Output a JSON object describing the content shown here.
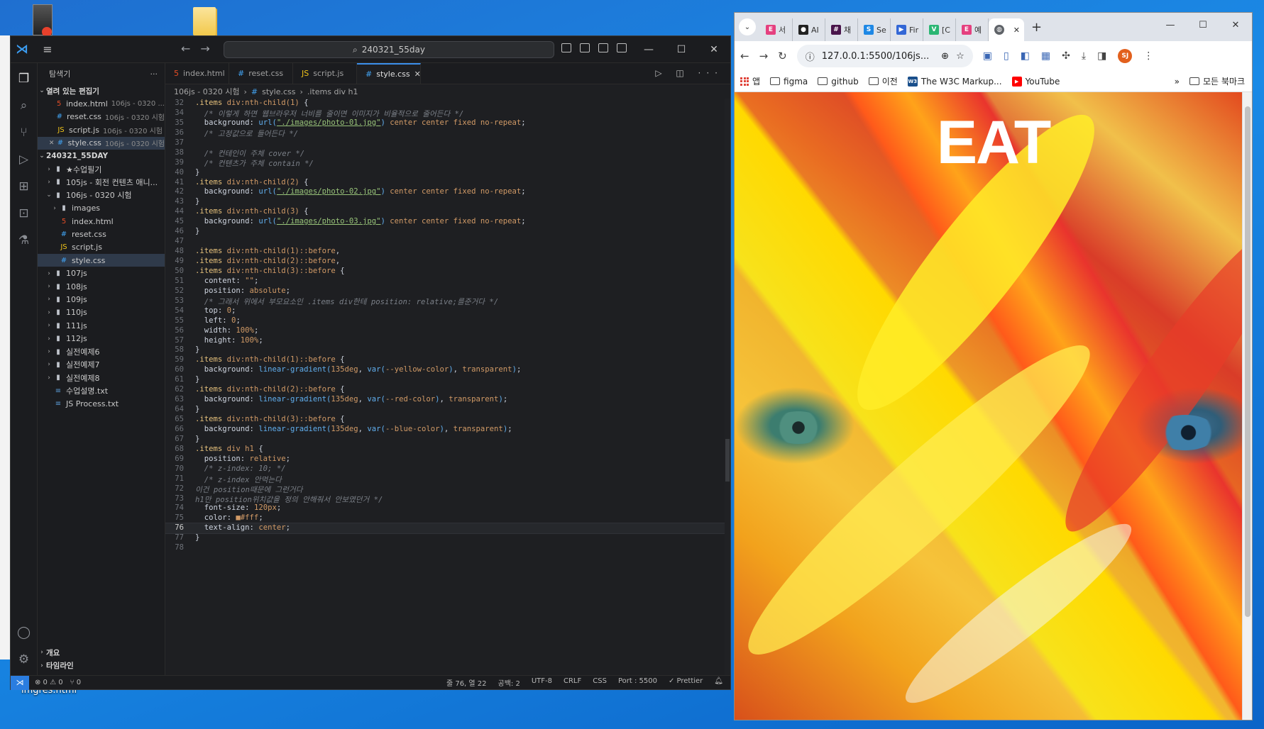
{
  "desktop": {
    "file_label": "imgres.html"
  },
  "vscode": {
    "search_text": "240321_55day",
    "explorer_title": "탐색기",
    "open_editors_label": "열려 있는 편집기",
    "open_editors": [
      {
        "name": "index.html",
        "desc": "106js - 0320 ...",
        "kind": "html"
      },
      {
        "name": "reset.css",
        "desc": "106js - 0320 시험",
        "kind": "css"
      },
      {
        "name": "script.js",
        "desc": "106js - 0320 시험",
        "kind": "js"
      },
      {
        "name": "style.css",
        "desc": "106js - 0320 시험",
        "kind": "css"
      }
    ],
    "workspace_label": "240321_55DAY",
    "tree": [
      {
        "name": "★수업필기",
        "kind": "folder",
        "indent": 1
      },
      {
        "name": "105js - 회전 컨텐츠 애니...",
        "kind": "folder",
        "indent": 1
      },
      {
        "name": "106js - 0320 시험",
        "kind": "folder-open",
        "indent": 1
      },
      {
        "name": "images",
        "kind": "folder",
        "indent": 2
      },
      {
        "name": "index.html",
        "kind": "html",
        "indent": 2
      },
      {
        "name": "reset.css",
        "kind": "css",
        "indent": 2
      },
      {
        "name": "script.js",
        "kind": "js",
        "indent": 2
      },
      {
        "name": "style.css",
        "kind": "css",
        "indent": 2
      },
      {
        "name": "107js",
        "kind": "folder",
        "indent": 1
      },
      {
        "name": "108js",
        "kind": "folder",
        "indent": 1
      },
      {
        "name": "109js",
        "kind": "folder",
        "indent": 1
      },
      {
        "name": "110js",
        "kind": "folder",
        "indent": 1
      },
      {
        "name": "111js",
        "kind": "folder",
        "indent": 1
      },
      {
        "name": "112js",
        "kind": "folder",
        "indent": 1
      },
      {
        "name": "실전예제6",
        "kind": "folder",
        "indent": 1
      },
      {
        "name": "실전예제7",
        "kind": "folder",
        "indent": 1
      },
      {
        "name": "실전예제8",
        "kind": "folder",
        "indent": 1
      },
      {
        "name": "수업설명.txt",
        "kind": "txt",
        "indent": 1
      },
      {
        "name": "JS Process.txt",
        "kind": "txt",
        "indent": 1
      }
    ],
    "outline_label": "개요",
    "timeline_label": "타임라인",
    "tabs": [
      {
        "name": "index.html",
        "kind": "html"
      },
      {
        "name": "reset.css",
        "kind": "css"
      },
      {
        "name": "script.js",
        "kind": "js"
      },
      {
        "name": "style.css",
        "kind": "css"
      }
    ],
    "breadcrumb": [
      "106js - 0320 시험",
      "style.css",
      ".items div h1"
    ],
    "code_lines": [
      {
        "n": "32",
        "parts": [
          [
            "sel",
            ".items "
          ],
          [
            "sel2",
            "div:nth-child(1)"
          ],
          [
            "txt",
            " {"
          ]
        ]
      },
      {
        "n": "34",
        "parts": [
          [
            "txt",
            "  "
          ],
          [
            "cmt",
            "/* 이렇게 하면 웹브라우저 너비를 줄이면 이미지가 비율적으로 줄어든다 */"
          ]
        ]
      },
      {
        "n": "35",
        "parts": [
          [
            "txt",
            "  "
          ],
          [
            "prop",
            "background: "
          ],
          [
            "fn",
            "url("
          ],
          [
            "str",
            "\"./images/photo-01.jpg\""
          ],
          [
            "fn",
            ")"
          ],
          [
            "val",
            " center center fixed no-repeat"
          ],
          [
            "txt",
            ";"
          ]
        ]
      },
      {
        "n": "36",
        "parts": [
          [
            "txt",
            "  "
          ],
          [
            "cmt",
            "/* 고정값으로 들어든다 */"
          ]
        ]
      },
      {
        "n": "37",
        "parts": []
      },
      {
        "n": "38",
        "parts": [
          [
            "txt",
            "  "
          ],
          [
            "cmt",
            "/* 컨테인이 주체 cover */"
          ]
        ]
      },
      {
        "n": "39",
        "parts": [
          [
            "txt",
            "  "
          ],
          [
            "cmt",
            "/* 컨텐츠가 주체 contain */"
          ]
        ]
      },
      {
        "n": "40",
        "parts": [
          [
            "txt",
            "}"
          ]
        ]
      },
      {
        "n": "41",
        "parts": [
          [
            "sel",
            ".items "
          ],
          [
            "sel2",
            "div:nth-child(2)"
          ],
          [
            "txt",
            " {"
          ]
        ]
      },
      {
        "n": "42",
        "parts": [
          [
            "txt",
            "  "
          ],
          [
            "prop",
            "background: "
          ],
          [
            "fn",
            "url("
          ],
          [
            "str",
            "\"./images/photo-02.jpg\""
          ],
          [
            "fn",
            ")"
          ],
          [
            "val",
            " center center fixed no-repeat"
          ],
          [
            "txt",
            ";"
          ]
        ]
      },
      {
        "n": "43",
        "parts": [
          [
            "txt",
            "}"
          ]
        ]
      },
      {
        "n": "44",
        "parts": [
          [
            "sel",
            ".items "
          ],
          [
            "sel2",
            "div:nth-child(3)"
          ],
          [
            "txt",
            " {"
          ]
        ]
      },
      {
        "n": "45",
        "parts": [
          [
            "txt",
            "  "
          ],
          [
            "prop",
            "background: "
          ],
          [
            "fn",
            "url("
          ],
          [
            "str",
            "\"./images/photo-03.jpg\""
          ],
          [
            "fn",
            ")"
          ],
          [
            "val",
            " center center fixed no-repeat"
          ],
          [
            "txt",
            ";"
          ]
        ]
      },
      {
        "n": "46",
        "parts": [
          [
            "txt",
            "}"
          ]
        ]
      },
      {
        "n": "47",
        "parts": []
      },
      {
        "n": "48",
        "parts": [
          [
            "sel",
            ".items "
          ],
          [
            "sel2",
            "div:nth-child(1)::before"
          ],
          [
            "txt",
            ","
          ]
        ]
      },
      {
        "n": "49",
        "parts": [
          [
            "sel",
            ".items "
          ],
          [
            "sel2",
            "div:nth-child(2)::before"
          ],
          [
            "txt",
            ","
          ]
        ]
      },
      {
        "n": "50",
        "parts": [
          [
            "sel",
            ".items "
          ],
          [
            "sel2",
            "div:nth-child(3)::before"
          ],
          [
            "txt",
            " {"
          ]
        ]
      },
      {
        "n": "51",
        "parts": [
          [
            "txt",
            "  "
          ],
          [
            "prop",
            "content: "
          ],
          [
            "val",
            "\"\""
          ],
          [
            "txt",
            ";"
          ]
        ]
      },
      {
        "n": "52",
        "parts": [
          [
            "txt",
            "  "
          ],
          [
            "prop",
            "position: "
          ],
          [
            "val",
            "absolute"
          ],
          [
            "txt",
            ";"
          ]
        ]
      },
      {
        "n": "53",
        "parts": [
          [
            "txt",
            "  "
          ],
          [
            "cmt",
            "/* 그래서 위에서 부모요소인 .items div한테 position: relative;를준거다 */"
          ]
        ]
      },
      {
        "n": "54",
        "parts": [
          [
            "txt",
            "  "
          ],
          [
            "prop",
            "top: "
          ],
          [
            "val",
            "0"
          ],
          [
            "txt",
            ";"
          ]
        ]
      },
      {
        "n": "55",
        "parts": [
          [
            "txt",
            "  "
          ],
          [
            "prop",
            "left: "
          ],
          [
            "val",
            "0"
          ],
          [
            "txt",
            ";"
          ]
        ]
      },
      {
        "n": "56",
        "parts": [
          [
            "txt",
            "  "
          ],
          [
            "prop",
            "width: "
          ],
          [
            "val",
            "100%"
          ],
          [
            "txt",
            ";"
          ]
        ]
      },
      {
        "n": "57",
        "parts": [
          [
            "txt",
            "  "
          ],
          [
            "prop",
            "height: "
          ],
          [
            "val",
            "100%"
          ],
          [
            "txt",
            ";"
          ]
        ]
      },
      {
        "n": "58",
        "parts": [
          [
            "txt",
            "}"
          ]
        ]
      },
      {
        "n": "59",
        "parts": [
          [
            "sel",
            ".items "
          ],
          [
            "sel2",
            "div:nth-child(1)::before"
          ],
          [
            "txt",
            " {"
          ]
        ]
      },
      {
        "n": "60",
        "parts": [
          [
            "txt",
            "  "
          ],
          [
            "prop",
            "background: "
          ],
          [
            "fn",
            "linear-gradient("
          ],
          [
            "val",
            "135deg"
          ],
          [
            "txt",
            ", "
          ],
          [
            "fn",
            "var("
          ],
          [
            "val",
            "--yellow-color"
          ],
          [
            "fn",
            ")"
          ],
          [
            "txt",
            ", "
          ],
          [
            "val",
            "transparent"
          ],
          [
            "fn",
            ")"
          ],
          [
            "txt",
            ";"
          ]
        ]
      },
      {
        "n": "61",
        "parts": [
          [
            "txt",
            "}"
          ]
        ]
      },
      {
        "n": "62",
        "parts": [
          [
            "sel",
            ".items "
          ],
          [
            "sel2",
            "div:nth-child(2)::before"
          ],
          [
            "txt",
            " {"
          ]
        ]
      },
      {
        "n": "63",
        "parts": [
          [
            "txt",
            "  "
          ],
          [
            "prop",
            "background: "
          ],
          [
            "fn",
            "linear-gradient("
          ],
          [
            "val",
            "135deg"
          ],
          [
            "txt",
            ", "
          ],
          [
            "fn",
            "var("
          ],
          [
            "val",
            "--red-color"
          ],
          [
            "fn",
            ")"
          ],
          [
            "txt",
            ", "
          ],
          [
            "val",
            "transparent"
          ],
          [
            "fn",
            ")"
          ],
          [
            "txt",
            ";"
          ]
        ]
      },
      {
        "n": "64",
        "parts": [
          [
            "txt",
            "}"
          ]
        ]
      },
      {
        "n": "65",
        "parts": [
          [
            "sel",
            ".items "
          ],
          [
            "sel2",
            "div:nth-child(3)::before"
          ],
          [
            "txt",
            " {"
          ]
        ]
      },
      {
        "n": "66",
        "parts": [
          [
            "txt",
            "  "
          ],
          [
            "prop",
            "background: "
          ],
          [
            "fn",
            "linear-gradient("
          ],
          [
            "val",
            "135deg"
          ],
          [
            "txt",
            ", "
          ],
          [
            "fn",
            "var("
          ],
          [
            "val",
            "--blue-color"
          ],
          [
            "fn",
            ")"
          ],
          [
            "txt",
            ", "
          ],
          [
            "val",
            "transparent"
          ],
          [
            "fn",
            ")"
          ],
          [
            "txt",
            ";"
          ]
        ]
      },
      {
        "n": "67",
        "parts": [
          [
            "txt",
            "}"
          ]
        ]
      },
      {
        "n": "68",
        "parts": [
          [
            "sel",
            ".items "
          ],
          [
            "sel2",
            "div h1"
          ],
          [
            "txt",
            " {"
          ]
        ]
      },
      {
        "n": "69",
        "parts": [
          [
            "txt",
            "  "
          ],
          [
            "prop",
            "position: "
          ],
          [
            "val",
            "relative"
          ],
          [
            "txt",
            ";"
          ]
        ]
      },
      {
        "n": "70",
        "parts": [
          [
            "txt",
            "  "
          ],
          [
            "cmt",
            "/* z-index: 10; */"
          ]
        ]
      },
      {
        "n": "71",
        "parts": [
          [
            "txt",
            "  "
          ],
          [
            "cmt",
            "/* z-index 안먹는다"
          ]
        ]
      },
      {
        "n": "72",
        "parts": [
          [
            "cmt",
            "이건 position때문에 그런거다"
          ]
        ]
      },
      {
        "n": "73",
        "parts": [
          [
            "cmt",
            "h1만 position위치값을 정의 안해줘서 안보였던거 */"
          ]
        ]
      },
      {
        "n": "74",
        "parts": [
          [
            "txt",
            "  "
          ],
          [
            "prop",
            "font-size: "
          ],
          [
            "val",
            "120px"
          ],
          [
            "txt",
            ";"
          ]
        ]
      },
      {
        "n": "75",
        "parts": [
          [
            "txt",
            "  "
          ],
          [
            "prop",
            "color: "
          ],
          [
            "val",
            "■#fff"
          ],
          [
            "txt",
            ";"
          ]
        ]
      },
      {
        "n": "76",
        "parts": [
          [
            "txt",
            "  "
          ],
          [
            "prop",
            "text-align: "
          ],
          [
            "val",
            "center"
          ],
          [
            "txt",
            ";"
          ]
        ],
        "current": true
      },
      {
        "n": "77",
        "parts": [
          [
            "txt",
            "}"
          ]
        ]
      },
      {
        "n": "78",
        "parts": []
      }
    ],
    "status": {
      "errors": "⊗ 0 ⚠ 0",
      "ports": "⑂ 0",
      "position": "줄 76, 열 22",
      "spaces": "공백: 2",
      "encoding": "UTF-8",
      "eol": "CRLF",
      "language": "CSS",
      "port": "Port : 5500",
      "prettier": "✓ Prettier"
    }
  },
  "chrome": {
    "tabs": [
      {
        "label": "서",
        "fav": "E",
        "color": "#e5407f"
      },
      {
        "label": "AI",
        "fav": "●",
        "color": "#222222"
      },
      {
        "label": "채",
        "fav": "#",
        "color": "#4a154b"
      },
      {
        "label": "Se",
        "fav": "S",
        "color": "#1e88e5"
      },
      {
        "label": "Fir",
        "fav": "▶",
        "color": "#3367d6"
      },
      {
        "label": "[C",
        "fav": "V",
        "color": "#2bb673"
      },
      {
        "label": "예",
        "fav": "E",
        "color": "#e5407f"
      }
    ],
    "url": "127.0.0.1:5500/106js...",
    "profile_initials": "SJ",
    "bookmarks": [
      {
        "label": "앱",
        "kind": "grid"
      },
      {
        "label": "figma",
        "kind": "folder"
      },
      {
        "label": "github",
        "kind": "folder"
      },
      {
        "label": "이전",
        "kind": "folder"
      },
      {
        "label": "The W3C Markup...",
        "kind": "w3c"
      },
      {
        "label": "YouTube",
        "kind": "youtube"
      }
    ],
    "all_bookmarks": "모든 북마크",
    "page_heading": "EAT"
  }
}
